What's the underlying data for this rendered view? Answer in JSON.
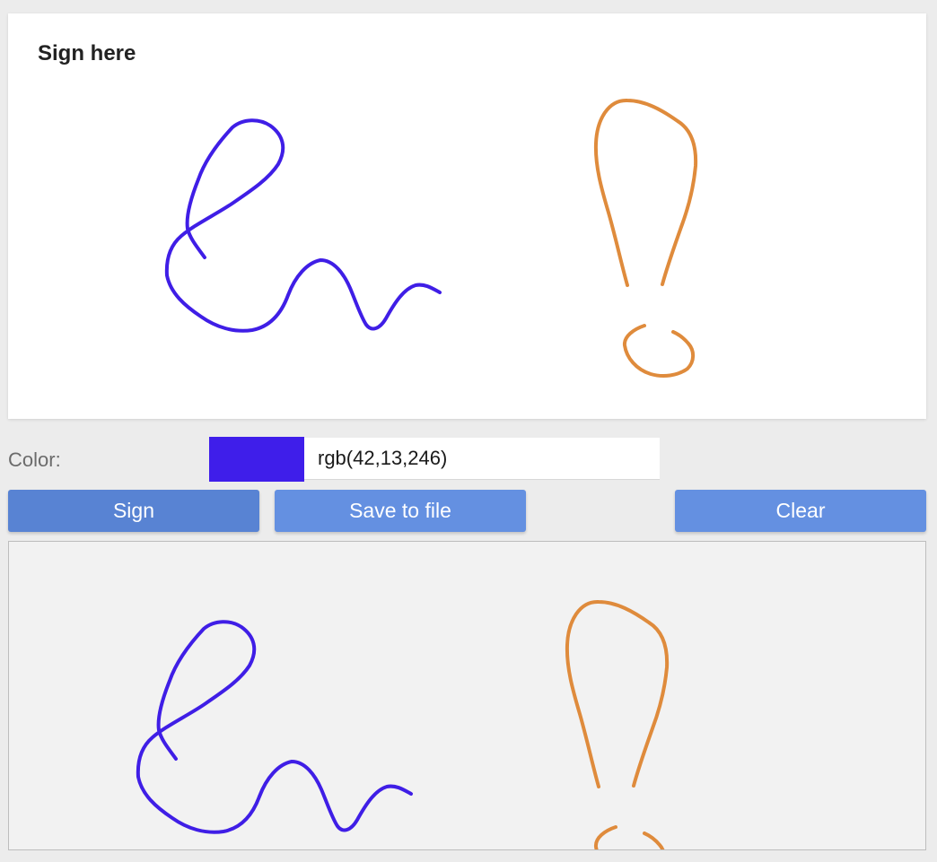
{
  "sign_pad": {
    "title": "Sign here"
  },
  "color_picker": {
    "label": "Color:",
    "value": "rgb(42,13,246)",
    "swatch_color": "#3f1eea"
  },
  "buttons": {
    "sign_label": "Sign",
    "save_label": "Save to file",
    "clear_label": "Clear"
  },
  "colors": {
    "page_background": "#ececec",
    "card_background": "#ffffff",
    "preview_background": "#f2f2f2",
    "sign_button": "#5883d3",
    "save_button": "#6490e1",
    "clear_button": "#6490e1",
    "stroke_blue": "#3f1ee6",
    "stroke_orange": "#df8b3c"
  }
}
